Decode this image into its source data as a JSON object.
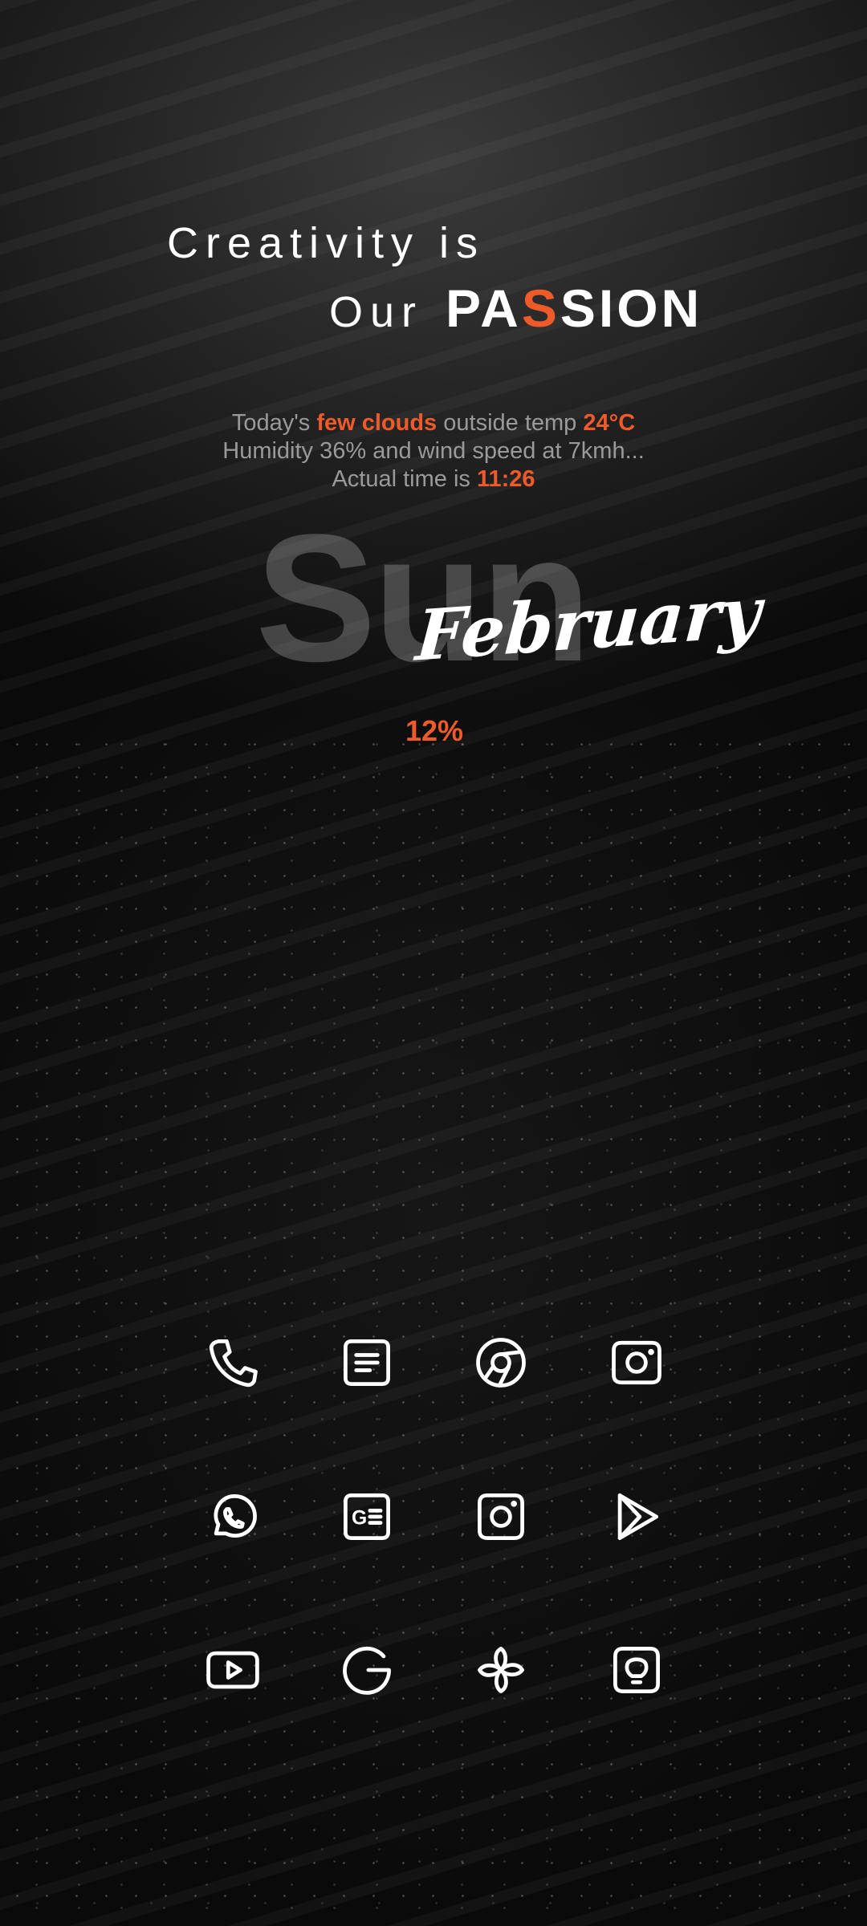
{
  "tagline": {
    "line1": "Creativity is",
    "line2_prefix": "Our",
    "passion_start": "PA",
    "passion_accent": "S",
    "passion_end": "SION"
  },
  "weather": {
    "line1_prefix": "Today's",
    "condition": "few clouds",
    "line1_middle": "outside temp",
    "temperature": "24°C",
    "line2": "Humidity 36% and wind speed at 7kmh...",
    "line3_prefix": "Actual time is",
    "time": "11:26"
  },
  "date": {
    "day": "Sun",
    "month": "February"
  },
  "battery": {
    "percent": "12%"
  },
  "news_icon_text": "G",
  "colors": {
    "accent": "#ef5a2a",
    "text_primary": "#ffffff",
    "text_muted": "#9a9a9a"
  },
  "apps": [
    {
      "icon": "phone-icon"
    },
    {
      "icon": "messages-icon"
    },
    {
      "icon": "chrome-icon"
    },
    {
      "icon": "camera-icon"
    },
    {
      "icon": "whatsapp-icon"
    },
    {
      "icon": "google-news-icon"
    },
    {
      "icon": "instagram-icon"
    },
    {
      "icon": "play-store-icon"
    },
    {
      "icon": "youtube-icon"
    },
    {
      "icon": "google-icon"
    },
    {
      "icon": "pinwheel-icon"
    },
    {
      "icon": "tips-icon"
    }
  ]
}
